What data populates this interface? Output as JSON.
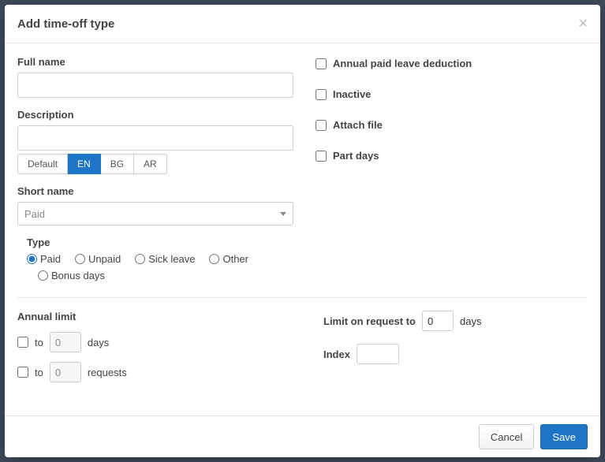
{
  "header": {
    "title": "Add time-off type"
  },
  "form": {
    "full_name": {
      "label": "Full name",
      "value": ""
    },
    "description": {
      "label": "Description",
      "value": ""
    },
    "lang_tabs": {
      "default": "Default",
      "en": "EN",
      "bg": "BG",
      "ar": "AR"
    },
    "short_name": {
      "label": "Short name",
      "selected": "Paid"
    },
    "type": {
      "label": "Type",
      "options": {
        "paid": "Paid",
        "unpaid": "Unpaid",
        "sick": "Sick leave",
        "other": "Other",
        "bonus": "Bonus days"
      }
    }
  },
  "flags": {
    "annual_paid": "Annual paid leave deduction",
    "inactive": "Inactive",
    "attach_file": "Attach file",
    "part_days": "Part days"
  },
  "limits": {
    "annual_limit_label": "Annual limit",
    "to": "to",
    "days": "days",
    "requests": "requests",
    "days_value": "0",
    "requests_value": "0",
    "limit_on_request_label": "Limit on request to",
    "limit_on_request_value": "0",
    "limit_on_request_unit": "days",
    "index_label": "Index",
    "index_value": ""
  },
  "footer": {
    "cancel": "Cancel",
    "save": "Save"
  }
}
